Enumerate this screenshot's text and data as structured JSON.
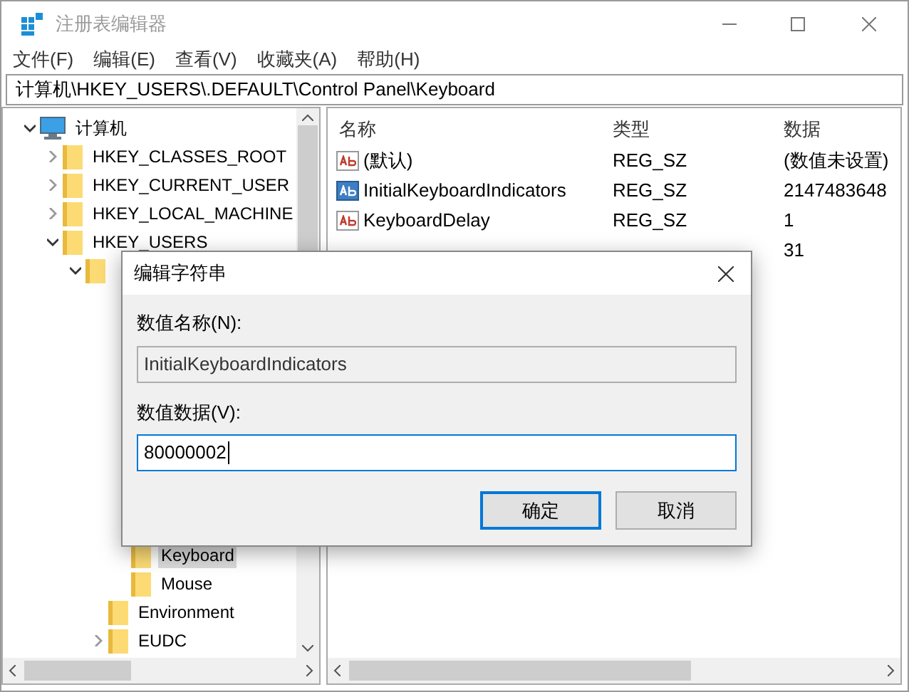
{
  "window": {
    "title": "注册表编辑器"
  },
  "menu": [
    "文件(F)",
    "编辑(E)",
    "查看(V)",
    "收藏夹(A)",
    "帮助(H)"
  ],
  "address": "计算机\\HKEY_USERS\\.DEFAULT\\Control Panel\\Keyboard",
  "tree": [
    {
      "label": "计算机",
      "kind": "computer",
      "expanded": true,
      "selected": false,
      "children": [
        {
          "label": "HKEY_CLASSES_ROOT",
          "expanded": false,
          "selected": false
        },
        {
          "label": "HKEY_CURRENT_USER",
          "expanded": false,
          "selected": false
        },
        {
          "label": "HKEY_LOCAL_MACHINE",
          "expanded": false,
          "selected": false
        },
        {
          "label": "HKEY_USERS",
          "expanded": true,
          "selected": false,
          "children": [
            {
              "expanded": true,
              "children": [
                {
                  "children": [
                    {
                      "label": "Keyboard",
                      "selected": true
                    },
                    {
                      "label": "Mouse",
                      "selected": false
                    }
                  ]
                },
                {
                  "label": "Environment",
                  "selected": false
                },
                {
                  "label": "EUDC",
                  "expanded": false,
                  "selected": false
                }
              ]
            }
          ]
        }
      ]
    }
  ],
  "table": {
    "columns": [
      "名称",
      "类型",
      "数据"
    ],
    "rows": [
      {
        "name": "(默认)",
        "type": "REG_SZ",
        "data": "(数值未设置)",
        "selected": false
      },
      {
        "name": "InitialKeyboardIndicators",
        "type": "REG_SZ",
        "data": "2147483648",
        "selected": true
      },
      {
        "name": "KeyboardDelay",
        "type": "REG_SZ",
        "data": "1",
        "selected": false
      },
      {
        "data": "31"
      }
    ]
  },
  "dialog": {
    "title": "编辑字符串",
    "name_label": "数值名称(N):",
    "name_value": "InitialKeyboardIndicators",
    "data_label": "数值数据(V):",
    "data_value": "80000002",
    "buttons": [
      {
        "label": "确定",
        "default": true
      },
      {
        "label": "取消",
        "default": false
      }
    ]
  }
}
